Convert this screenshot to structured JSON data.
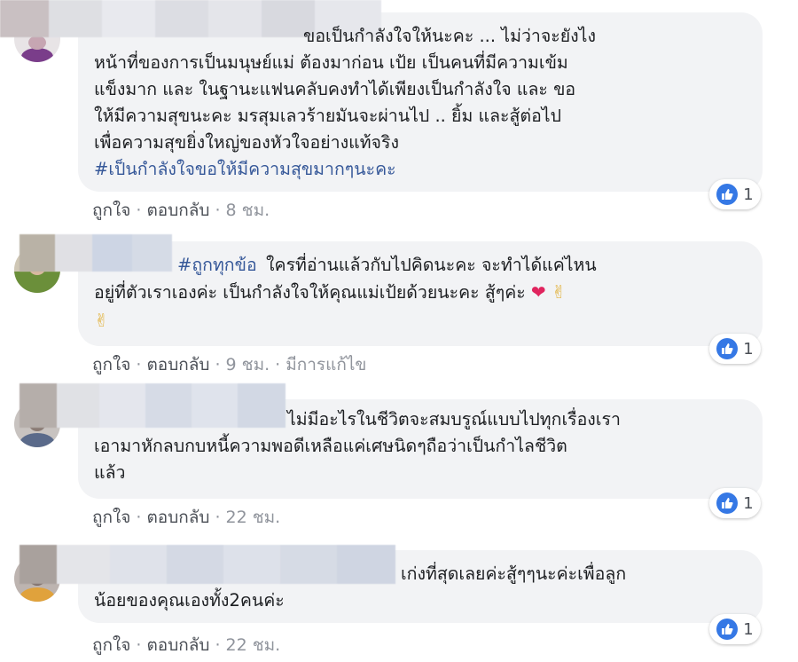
{
  "comments": [
    {
      "text_lines": [
        "ขอเป็นกำลังใจให้นะคะ ... ไม่ว่าจะยังไง",
        "หน้าที่ของการเป็นมนุษย์แม่ ต้องมาก่อน เป้ย เป็นคนที่มีความเข้ม",
        "แข็งมาก และ ในฐานะแฟนคลับคงทำได้เพียงเป็นกำลังใจ และ ขอ",
        "ให้มีความสุขนะคะ มรสุมเลวร้ายมันจะผ่านไป .. ยิ้ม และสู้ต่อไป",
        "เพื่อความสุขยิ่งใหญ่ของหัวใจอย่างแท้จริง"
      ],
      "hashtag": "#เป็นกำลังใจขอให้มีความสุขมากๆนะคะ",
      "like_label": "ถูกใจ",
      "reply_label": "ตอบกลับ",
      "time": "8 ชม.",
      "reaction_count": "1"
    },
    {
      "hashtag": "#ถูกทุกข้อ",
      "text_lines": [
        "ใครที่อ่านแล้วกับไปคิดนะคะ จะทำได้แค่ไหน",
        "อยู่ที่ตัวเราเองค่ะ เป็นกำลังใจให้คุณแม่เป้ยด้วยนะคะ สู้ๆค่ะ"
      ],
      "emoji": [
        "heart",
        "victory-hand",
        "victory-hand"
      ],
      "heart_glyph": "❤",
      "victory_glyph": "✌",
      "like_label": "ถูกใจ",
      "reply_label": "ตอบกลับ",
      "time": "9 ชม.",
      "edited_label": "มีการแก้ไข",
      "reaction_count": "1"
    },
    {
      "text_lines": [
        "ไม่มีอะไรในชีวิตจะสมบรูณ์แบบไปทุกเรื่องเรา",
        "เอามาหักลบกบหนี้ความพอดีเหลือแค่เศษนิดๆถือว่าเป็นกำไลชีวิต",
        "แล้ว"
      ],
      "like_label": "ถูกใจ",
      "reply_label": "ตอบกลับ",
      "time": "22 ชม.",
      "reaction_count": "1"
    },
    {
      "text_lines": [
        "เก่งที่สุดเลยค่ะสู้ๆๆนะค่ะเพื่อลูก",
        "น้อยของคุณเองทั้ง2คนค่ะ"
      ],
      "like_label": "ถูกใจ",
      "reply_label": "ตอบกลับ",
      "time": "22 ชม.",
      "reaction_count": "1"
    }
  ],
  "separator": "·",
  "colors": {
    "bubble": "#f2f3f5",
    "hashtag": "#365899",
    "like_blue": "#3578e5",
    "meta_text": "#90949c"
  },
  "icons": {
    "like": "thumbs-up-icon",
    "heart": "heart-icon",
    "victory": "victory-hand-icon"
  }
}
